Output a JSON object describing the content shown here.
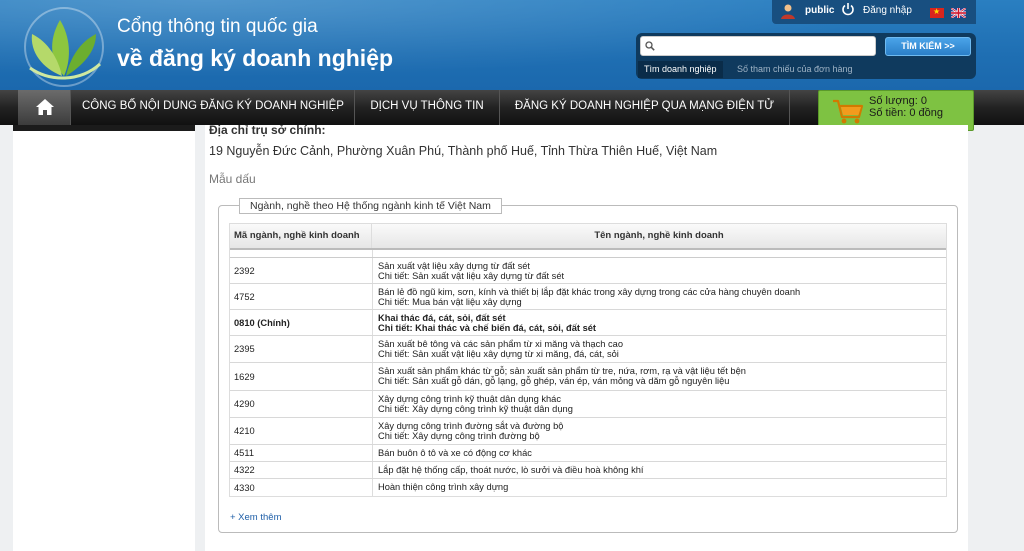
{
  "header": {
    "title_line1": "Cổng thông tin quốc gia",
    "title_line2": "về đăng ký doanh nghiệp"
  },
  "topbar": {
    "user": "public",
    "login": "Đăng nhập"
  },
  "search": {
    "placeholder": "",
    "button": "TÌM KIẾM >>",
    "tab_active": "Tìm doanh nghiệp",
    "tab_other": "Số tham chiếu của đơn hàng"
  },
  "nav": {
    "items": [
      "CÔNG BỐ NỘI DUNG ĐĂNG KÝ DOANH NGHIỆP",
      "DỊCH VỤ THÔNG TIN",
      "ĐĂNG KÝ DOANH NGHIỆP QUA MẠNG ĐIỆN TỬ"
    ]
  },
  "cart": {
    "quantity": "Số lượng: 0",
    "amount": "Số tiền: 0 đồng"
  },
  "details": {
    "address_label": "Địa chỉ trụ sở chính:",
    "address_value": "19 Nguyễn Đức Cảnh, Phường Xuân Phú, Thành phố Huế, Tỉnh Thừa Thiên Huế, Việt Nam",
    "stamp_label": "Mẫu dấu"
  },
  "industry": {
    "legend": "Ngành, nghề theo Hệ thống ngành kinh tế Việt Nam",
    "col_code": "Mã ngành, nghề kinh doanh",
    "col_name": "Tên ngành, nghề kinh doanh",
    "rows": [
      {
        "code": "2392",
        "name": "Sản xuất vật liệu xây dựng từ đất sét",
        "detail": "Chi tiết: Sản xuất vật liệu xây dựng từ đất sét"
      },
      {
        "code": "4752",
        "name": "Bán lẻ đồ ngũ kim, sơn, kính và thiết bị lắp đặt khác trong xây dựng trong các cửa hàng chuyên doanh",
        "detail": "Chi tiết: Mua bán vật liệu xây dựng"
      },
      {
        "code": "0810 (Chính)",
        "name": "Khai thác đá, cát, sỏi, đất sét",
        "detail": "Chi tiết: Khai thác và chế biến đá, cát, sỏi, đất sét"
      },
      {
        "code": "2395",
        "name": "Sản xuất bê tông và các sản phẩm từ xi măng và thạch cao",
        "detail": "Chi tiết: Sản xuất vật liệu xây dựng từ xi măng, đá, cát, sỏi"
      },
      {
        "code": "1629",
        "name": "Sản xuất sản phẩm khác từ gỗ; sản xuất sản phẩm từ tre, nứa, rơm, rạ và vật liệu tết bện",
        "detail": "Chi tiết: Sản xuất gỗ dán, gỗ lạng, gỗ ghép, ván ép, ván mỏng và dăm gỗ nguyên liệu"
      },
      {
        "code": "4290",
        "name": "Xây dựng công trình kỹ thuật dân dụng khác",
        "detail": "Chi tiết: Xây dựng công trình kỹ thuật dân dụng"
      },
      {
        "code": "4210",
        "name": "Xây dựng công trình đường sắt và đường bộ",
        "detail": "Chi tiết: Xây dựng công trình đường bộ"
      },
      {
        "code": "4511",
        "name": "Bán buôn ô tô và xe có động cơ khác",
        "detail": ""
      },
      {
        "code": "4322",
        "name": "Lắp đặt hệ thống cấp, thoát nước, lò sưởi và điều hoà không khí",
        "detail": ""
      },
      {
        "code": "4330",
        "name": "Hoàn thiện công trình xây dựng",
        "detail": ""
      }
    ],
    "more_link": "+ Xem thêm"
  },
  "colors": {
    "header_blue": "#1f6fb3",
    "nav_dark": "#222222",
    "cart_green": "#7ec242",
    "link_blue": "#1f5fa8"
  },
  "icons": [
    "logo-leaf-icon",
    "user-icon",
    "power-icon",
    "flag-vn-icon",
    "flag-uk-icon",
    "search-icon",
    "home-icon",
    "cart-icon"
  ]
}
